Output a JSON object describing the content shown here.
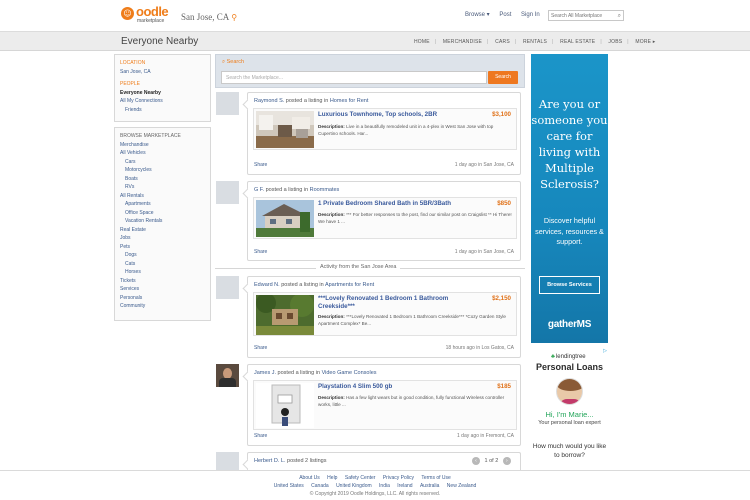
{
  "header": {
    "logo_word": "oodle",
    "logo_sub": "marketplace",
    "city": "San Jose, CA",
    "nav": [
      "Browse ▾",
      "Post",
      "Sign In"
    ],
    "search_placeholder": "Search All Marketplace"
  },
  "band": {
    "title": "Everyone Nearby",
    "categories": [
      "HOME",
      "MERCHANDISE",
      "CARS",
      "RENTALS",
      "REAL ESTATE",
      "JOBS",
      "MORE ▸"
    ]
  },
  "sidebar": {
    "location_heading": "LOCATION",
    "location_value": "San Jose, CA",
    "people_heading": "PEOPLE",
    "people": [
      "Everyone Nearby",
      "All My Connections",
      "Friends"
    ],
    "browse_heading": "BROWSE MARKETPLACE",
    "browse": [
      {
        "label": "Merchandise",
        "indent": false
      },
      {
        "label": "All Vehicles",
        "indent": false
      },
      {
        "label": "Cars",
        "indent": true
      },
      {
        "label": "Motorcycles",
        "indent": true
      },
      {
        "label": "Boats",
        "indent": true
      },
      {
        "label": "RVs",
        "indent": true
      },
      {
        "label": "All Rentals",
        "indent": false
      },
      {
        "label": "Apartments",
        "indent": true
      },
      {
        "label": "Office Space",
        "indent": true
      },
      {
        "label": "Vacation Rentals",
        "indent": true
      },
      {
        "label": "Real Estate",
        "indent": false
      },
      {
        "label": "Jobs",
        "indent": false
      },
      {
        "label": "Pets",
        "indent": false
      },
      {
        "label": "Dogs",
        "indent": true
      },
      {
        "label": "Cats",
        "indent": true
      },
      {
        "label": "Horses",
        "indent": true
      },
      {
        "label": "Tickets",
        "indent": false
      },
      {
        "label": "Services",
        "indent": false
      },
      {
        "label": "Personals",
        "indent": false
      },
      {
        "label": "Community",
        "indent": false
      }
    ]
  },
  "search": {
    "label": "Search",
    "placeholder": "Search the Marketplace...",
    "button": "Search"
  },
  "feed": [
    {
      "poster": "Raymond S.",
      "action": "posted a listing in",
      "category": "Homes for Rent",
      "title": "Luxurious Townhome, Top schools, 2BR",
      "price": "$3,100",
      "desc_label": "Description:",
      "desc": "Live in a beautifully remodeled unit in a 4-plex in West San Jose with top Cupertino schools. Har...",
      "share": "Share",
      "meta": "1 day ago in San Jose, CA"
    },
    {
      "poster": "G F.",
      "action": "posted a listing in",
      "category": "Roommates",
      "title": "1 Private Bedroom Shared Bath in 5BR/3Bath",
      "price": "$850",
      "desc_label": "Description:",
      "desc": "*** For better responses to the post, find our similar post on Craigslist ** Hi There! We have 1 ...",
      "share": "Share",
      "meta": "1 day ago in San Jose, CA"
    },
    {
      "poster": "Edward N.",
      "action": "posted a listing in",
      "category": "Apartments for Rent",
      "title": "***Lovely Renovated 1 Bedroom 1 Bathroom Creekside***",
      "price": "$2,150",
      "desc_label": "Description:",
      "desc": "***Lovely Renovated 1 Bedroom 1 Bathroom Creekside*** *Cozy Garden Style Apartment Complex* Be...",
      "share": "Share",
      "meta": "18 hours ago in Los Gatos, CA"
    },
    {
      "poster": "James J.",
      "action": "posted a listing in",
      "category": "Video Game Consoles",
      "title": "Playstation 4 Slim 500 gb",
      "price": "$185",
      "desc_label": "Description:",
      "desc": "Has a few light wears but in good condition, fully functional Wireless controller works, little ...",
      "share": "Share",
      "meta": "1 day ago in Fremont, CA"
    }
  ],
  "divider": "Activity from the San Jose Area",
  "last_post": {
    "poster": "Herbert D. L.",
    "action": "posted 2 listings",
    "pager": "1 of 2"
  },
  "ad1": {
    "question": "Are you or someone you care for living with Multiple Sclerosis?",
    "sub": "Discover helpful services, resources & support.",
    "button": "Browse Services",
    "brand": "gatherMS"
  },
  "ad2": {
    "brand": "lendingtree",
    "headline": "Personal Loans",
    "greeting": "Hi, I'm Marie...",
    "role": "Your personal loan expert",
    "question": "How much would you like to borrow?"
  },
  "footer": {
    "links1": [
      "About Us",
      "Help",
      "Safety Center",
      "Privacy Policy",
      "Terms of Use"
    ],
    "links2": [
      "United States",
      "Canada",
      "United Kingdom",
      "India",
      "Ireland",
      "Australia",
      "New Zealand"
    ],
    "copyright": "© Copyright 2019 Oodle Holdings, LLC. All rights reserved."
  }
}
